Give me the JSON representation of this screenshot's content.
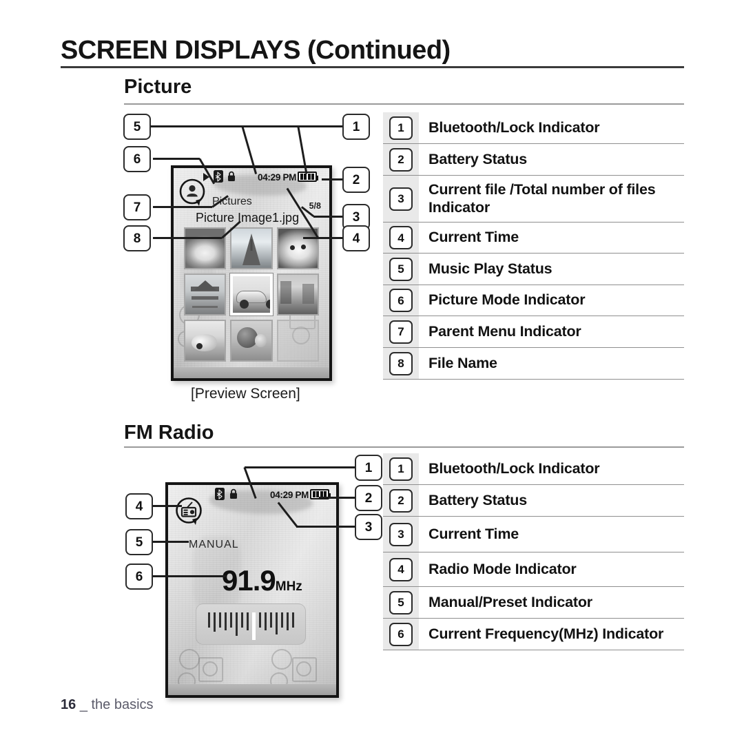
{
  "document": {
    "title": "SCREEN DISPLAYS (Continued)",
    "footer_page": "16",
    "footer_label": "_ the basics"
  },
  "sections": [
    {
      "heading": "Picture",
      "caption": "[Preview Screen]",
      "screen": {
        "status_bar": {
          "play_icon": "play-icon",
          "bluetooth_icon": "bluetooth-icon",
          "lock_icon": "lock-icon",
          "time": "04:29 PM",
          "battery_icon": "battery-full-icon",
          "battery_cells": 4
        },
        "mode_icon": "picture-mode-icon",
        "parent_menu": "Pictures",
        "file_name": "Picture Image1.jpg",
        "file_counter": "5/8",
        "thumbnails": [
          {
            "name": "dog-white-thumbnail",
            "selected": false
          },
          {
            "name": "eiffel-tower-thumbnail",
            "selected": false
          },
          {
            "name": "golden-retriever-thumbnail",
            "selected": false
          },
          {
            "name": "pagoda-thumbnail",
            "selected": false
          },
          {
            "name": "vintage-car-thumbnail",
            "selected": true
          },
          {
            "name": "street-market-thumbnail",
            "selected": false
          },
          {
            "name": "seal-thumbnail",
            "selected": false
          },
          {
            "name": "balloons-thumbnail",
            "selected": false
          },
          {
            "name": "empty-slot",
            "selected": false
          }
        ]
      },
      "callouts": [
        "5",
        "6",
        "7",
        "8",
        "1",
        "2",
        "3",
        "4"
      ],
      "legend": [
        {
          "num": "1",
          "label": "Bluetooth/Lock Indicator"
        },
        {
          "num": "2",
          "label": "Battery Status"
        },
        {
          "num": "3",
          "label": "Current file /Total number of files Indicator"
        },
        {
          "num": "4",
          "label": "Current Time"
        },
        {
          "num": "5",
          "label": "Music Play Status"
        },
        {
          "num": "6",
          "label": "Picture Mode Indicator"
        },
        {
          "num": "7",
          "label": "Parent Menu Indicator"
        },
        {
          "num": "8",
          "label": "File Name"
        }
      ]
    },
    {
      "heading": "FM Radio",
      "screen": {
        "status_bar": {
          "bluetooth_icon": "bluetooth-icon",
          "lock_icon": "lock-icon",
          "time": "04:29 PM",
          "battery_icon": "battery-full-icon",
          "battery_cells": 4
        },
        "mode_icon": "radio-mode-icon",
        "tuning_mode": "MANUAL",
        "frequency_value": "91.9",
        "frequency_unit": "MHz",
        "tuner_ticks": 16,
        "tuner_current_index": 8
      },
      "callouts": [
        "1",
        "2",
        "3",
        "4",
        "5",
        "6"
      ],
      "legend": [
        {
          "num": "1",
          "label": "Bluetooth/Lock Indicator"
        },
        {
          "num": "2",
          "label": "Battery Status"
        },
        {
          "num": "3",
          "label": "Current Time"
        },
        {
          "num": "4",
          "label": "Radio Mode Indicator"
        },
        {
          "num": "5",
          "label": "Manual/Preset Indicator"
        },
        {
          "num": "6",
          "label": "Current Frequency(MHz) Indicator"
        }
      ]
    }
  ]
}
